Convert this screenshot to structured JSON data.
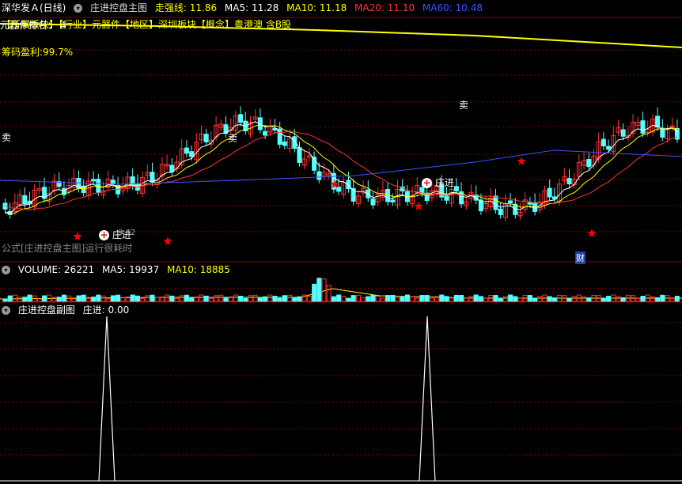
{
  "header": {
    "stock": "深华发Ａ(日线)",
    "indicator": "庄进控盘主图",
    "lines": [
      {
        "label": "走强线: 11.86",
        "color": "#ffff00"
      },
      {
        "label": "MA5: 11.28",
        "color": "#ffffff"
      },
      {
        "label": "MA10: 11.18",
        "color": "#ffff00"
      },
      {
        "label": "MA20: 11.10",
        "color": "#ff3333"
      },
      {
        "label": "MA60: 10.48",
        "color": "#3355ff"
      }
    ]
  },
  "sector_line": "【所属板块】【行业】元器件【地区】深圳板块【概念】粤港澳 含B股",
  "rank_label": "元器件排名： 4",
  "chip_profit": "筹码盈利:99.7%",
  "annotations": {
    "sell1": "卖",
    "sell2": "卖",
    "sell3": "卖",
    "enter1": "庄进",
    "enter2": "庄进",
    "low_price": "9.62",
    "fin": "财",
    "slow_note": "公式[庄进控盘主图]运行很耗时"
  },
  "volume_header": {
    "label": "VOLUME: 26221",
    "ma5": "MA5: 19937",
    "ma10": "MA10: 18885"
  },
  "sub_header": {
    "label": "庄进控盘副图",
    "value": "庄进: 0.00"
  },
  "colors": {
    "up": "#ff3333",
    "down": "#54ffff",
    "ma5": "#ffffff",
    "ma10": "#ffff00",
    "ma20": "#ff3333",
    "ma60": "#3355ff",
    "grid": "#8b0000",
    "star": "#ff0000"
  }
}
